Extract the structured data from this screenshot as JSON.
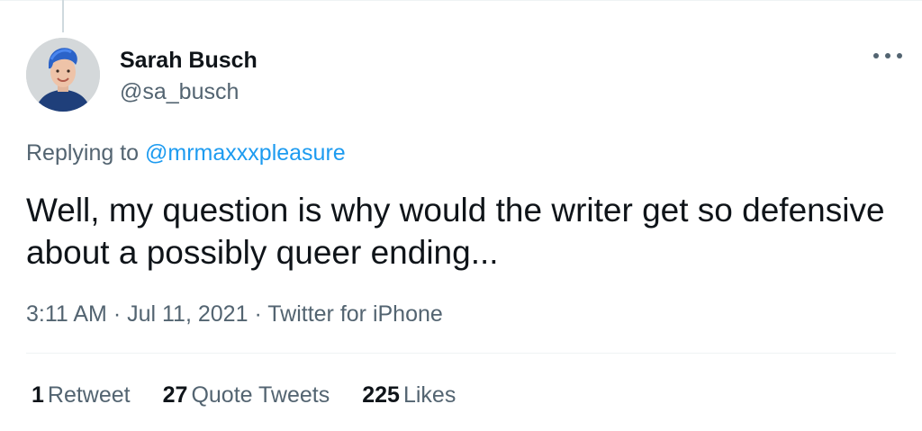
{
  "author": {
    "name": "Sarah Busch",
    "handle": "@sa_busch"
  },
  "reply": {
    "prefix": "Replying to",
    "to": "@mrmaxxxpleasure"
  },
  "tweet": {
    "text": "Well, my question is why would the writer get so defensive about a possibly queer ending..."
  },
  "meta": {
    "time": "3:11 AM",
    "separator": "·",
    "date": "Jul 11, 2021",
    "source": "Twitter for iPhone"
  },
  "stats": {
    "retweets_count": "1",
    "retweets_label": "Retweet",
    "quotes_count": "27",
    "quotes_label": "Quote Tweets",
    "likes_count": "225",
    "likes_label": "Likes"
  },
  "colors": {
    "link": "#1d9bf0",
    "secondary_text": "#536471",
    "primary_text": "#0f1419",
    "avatar_hair": "#2b63c8"
  },
  "icons": {
    "more": "more-dots-icon"
  }
}
